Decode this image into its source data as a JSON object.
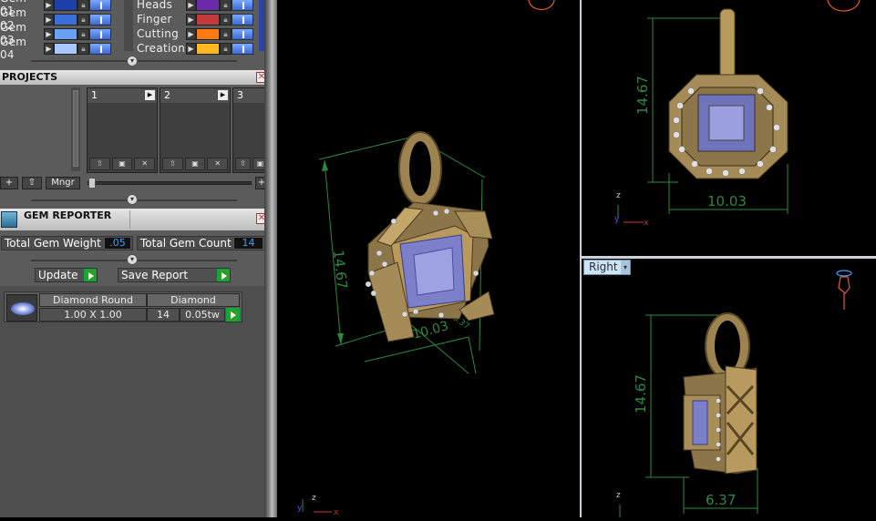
{
  "layers": {
    "gems": [
      {
        "label": "Gem 01",
        "color": "#1d3fa8"
      },
      {
        "label": "Gem 02",
        "color": "#3a6fd8"
      },
      {
        "label": "Gem 03",
        "color": "#6aa0f2"
      },
      {
        "label": "Gem 04",
        "color": "#a8c8ff"
      }
    ],
    "metals": [
      {
        "label": "Heads",
        "color": "#6b2aa8"
      },
      {
        "label": "Finger",
        "color": "#c23a3a"
      },
      {
        "label": "Cutting",
        "color": "#ff7a10"
      },
      {
        "label": "Creation",
        "color": "#ffb820"
      }
    ]
  },
  "projects": {
    "title": "PROJECTS",
    "slots": [
      "1",
      "2",
      "3"
    ],
    "manager_label": "Mngr"
  },
  "gem_reporter": {
    "title": "GEM REPORTER",
    "total_weight_label": "Total Gem Weight",
    "total_weight_value": ".05",
    "total_count_label": "Total Gem Count",
    "total_count_value": "14",
    "update_label": "Update",
    "save_label": "Save Report",
    "row": {
      "shape": "Diamond Round",
      "material": "Diamond",
      "size": "1.00 X 1.00",
      "count": "14",
      "weight": "0.05tw"
    }
  },
  "viewports": {
    "perspective": {
      "dim_height": "14.67",
      "dim_width": "10.03",
      "dim_depth": "6.37"
    },
    "front": {
      "dim_height": "14.67",
      "dim_width": "10.03"
    },
    "right": {
      "label": "Right",
      "dim_height": "14.67",
      "dim_width": "6.37"
    }
  },
  "colors": {
    "panel_bg": "#5b5b5b",
    "dimension_green": "#2c8a3f",
    "gold": "#b89a5e",
    "gem": "#8a8fd8",
    "viewport_divider": "#cfd3d8",
    "accent_blue": "#39a0ff"
  }
}
